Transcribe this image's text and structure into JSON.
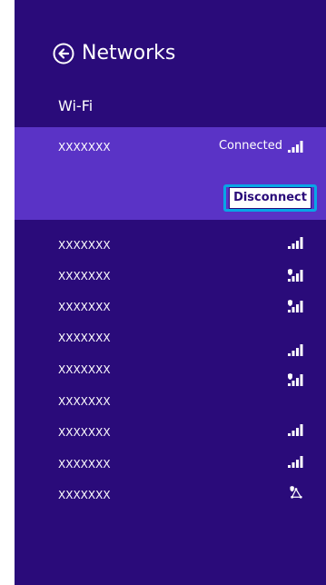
{
  "header": {
    "title": "Networks",
    "back_icon": "arrow-left-circle-icon"
  },
  "section": {
    "label": "Wi-Fi"
  },
  "connected_network": {
    "name": "XXXXXXX",
    "status": "Connected",
    "signal_icon": "wifi-signal-icon",
    "action_label": "Disconnect",
    "highlight_color": "#08a6e6"
  },
  "networks": [
    {
      "name": "XXXXXXX",
      "icon": "wifi-signal-icon"
    },
    {
      "name": "XXXXXXX",
      "icon": "secured-wifi-signal-icon"
    },
    {
      "name": "XXXXXXX",
      "icon": "secured-wifi-signal-icon"
    },
    {
      "name": "XXXXXXX",
      "icon": "wifi-signal-icon"
    },
    {
      "name": "XXXXXXX",
      "icon": "secured-wifi-signal-icon"
    },
    {
      "name": "XXXXXXX",
      "icon": "none"
    },
    {
      "name": "XXXXXXX",
      "icon": "wifi-signal-icon"
    },
    {
      "name": "XXXXXXX",
      "icon": "wifi-signal-icon"
    },
    {
      "name": "XXXXXXX",
      "icon": "secured-network-icon"
    }
  ],
  "colors": {
    "panel": "#2a0b7a",
    "selected_row": "#5a33c6"
  }
}
